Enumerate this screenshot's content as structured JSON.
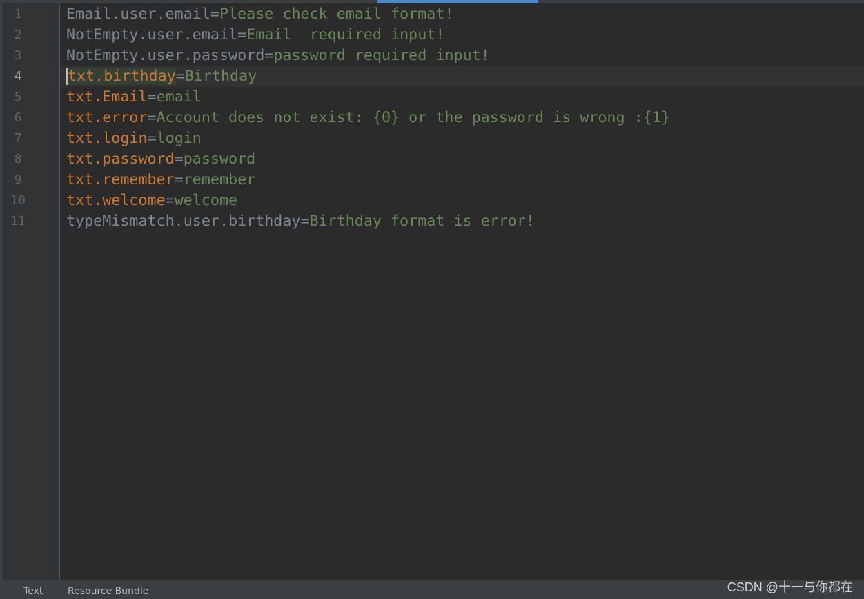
{
  "editor": {
    "current_line": 4,
    "lines": [
      {
        "num": "1",
        "key": "Email.user.email",
        "value": "Please check email format!",
        "key_style": "gray"
      },
      {
        "num": "2",
        "key": "NotEmpty.user.email",
        "value": "Email  required input!",
        "key_style": "gray"
      },
      {
        "num": "3",
        "key": "NotEmpty.user.password",
        "value": "password required input!",
        "key_style": "gray"
      },
      {
        "num": "4",
        "key": "txt.birthday",
        "value": "Birthday",
        "key_style": "orange"
      },
      {
        "num": "5",
        "key": "txt.Email",
        "value": "email",
        "key_style": "orange"
      },
      {
        "num": "6",
        "key": "txt.error",
        "value": "Account does not exist: {0} or the password is wrong :{1}",
        "key_style": "orange"
      },
      {
        "num": "7",
        "key": "txt.login",
        "value": "login",
        "key_style": "orange"
      },
      {
        "num": "8",
        "key": "txt.password",
        "value": "password",
        "key_style": "orange"
      },
      {
        "num": "9",
        "key": "txt.remember",
        "value": "remember",
        "key_style": "orange"
      },
      {
        "num": "10",
        "key": "txt.welcome",
        "value": "welcome",
        "key_style": "orange"
      },
      {
        "num": "11",
        "key": "typeMismatch.user.birthday",
        "value": "Birthday format is error!",
        "key_style": "gray"
      }
    ],
    "separator": "="
  },
  "bottom_tabs": {
    "text": "Text",
    "resource_bundle": "Resource Bundle"
  },
  "watermark": "CSDN @十一与你都在",
  "colors": {
    "key_gray": "#7f8691",
    "key_orange": "#cc7832",
    "value_green": "#6a8759",
    "background": "#2b2b2b",
    "accent": "#4a88c7"
  }
}
